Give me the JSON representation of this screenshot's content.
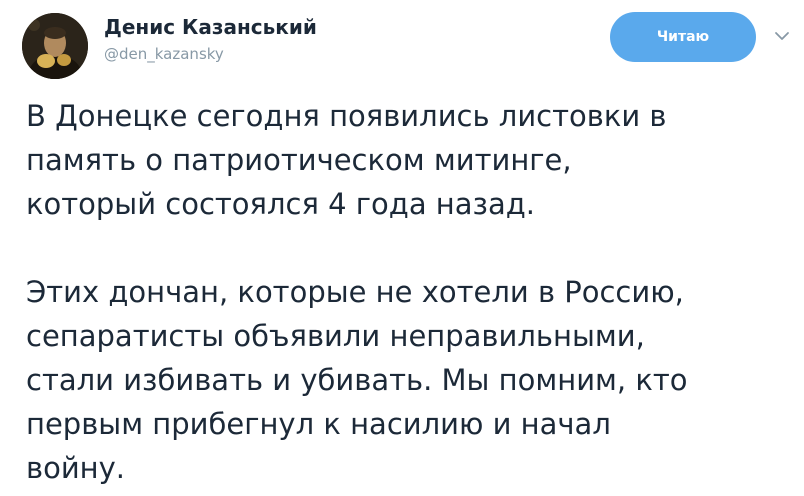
{
  "author": {
    "name": "Денис Казанський",
    "handle": "@den_kazansky"
  },
  "follow_button": {
    "label": "Читаю"
  },
  "icons": {
    "caret": "chevron-down-icon",
    "avatar": "avatar-photo"
  },
  "colors": {
    "follow_button": "#5aa9ec",
    "text": "#1c2938",
    "handle": "#8899a6"
  },
  "tweet": {
    "paragraphs": [
      "В Донецке сегодня появились листовки в\nпамять о патриотическом митинге,\nкоторый состоялся 4 года назад.",
      "Этих дончан, которые не хотели в Россию,\nсепаратисты объявили неправильными,\nстали избивать и убивать. Мы помним, кто\nпервым прибегнул к насилию и начал\nвойну."
    ]
  }
}
